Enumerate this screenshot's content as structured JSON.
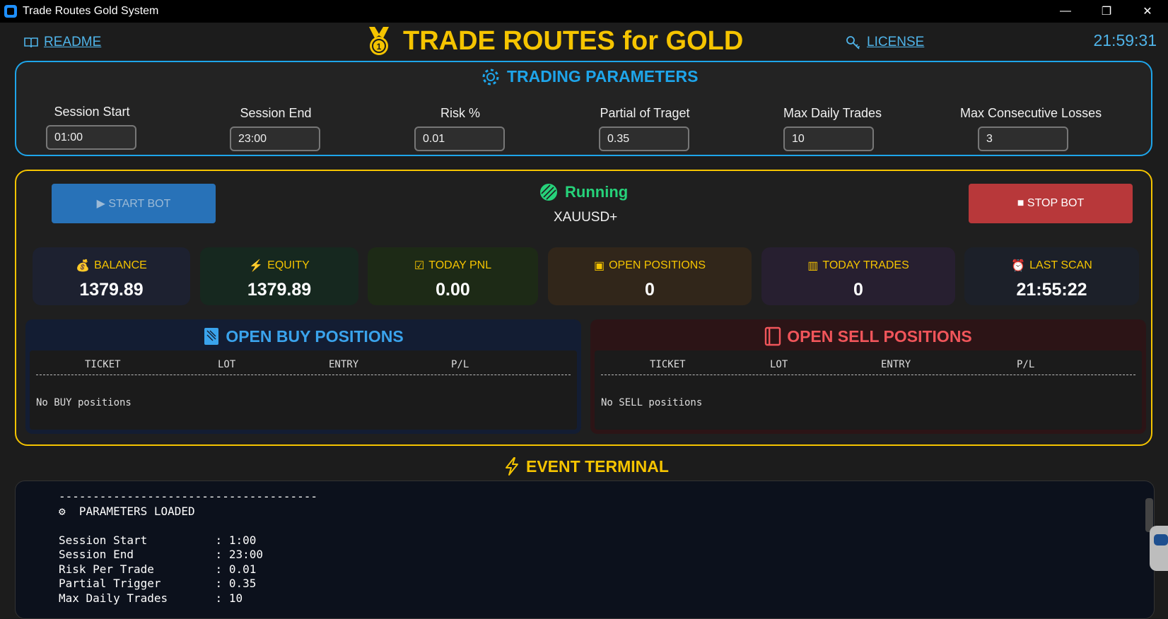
{
  "window": {
    "title": "Trade Routes Gold System",
    "controls": [
      "—",
      "❐",
      "✕"
    ]
  },
  "header": {
    "readme_label": "README",
    "app_title": "TRADE ROUTES for GOLD",
    "license_label": "LICENSE",
    "clock": "21:59:31"
  },
  "parameters": {
    "title": "TRADING PARAMETERS",
    "fields": [
      {
        "label": "Session Start",
        "value": "01:00"
      },
      {
        "label": "Session End",
        "value": "23:00"
      },
      {
        "label": "Risk %",
        "value": "0.01"
      },
      {
        "label": "Partial of Traget",
        "value": "0.35"
      },
      {
        "label": "Max Daily Trades",
        "value": "10"
      },
      {
        "label": "Max Consecutive Losses",
        "value": "3"
      }
    ]
  },
  "controls": {
    "start_label": "▶ START BOT",
    "stop_label": "■ STOP BOT",
    "status": "Running",
    "symbol": "XAUUSD+"
  },
  "stats": [
    {
      "label": "BALANCE",
      "value": "1379.89",
      "icon": "moneybag-icon"
    },
    {
      "label": "EQUITY",
      "value": "1379.89",
      "icon": "lightning-icon"
    },
    {
      "label": "TODAY PNL",
      "value": "0.00",
      "icon": "chart-icon"
    },
    {
      "label": "OPEN POSITIONS",
      "value": "0",
      "icon": "box-icon"
    },
    {
      "label": "TODAY TRADES",
      "value": "0",
      "icon": "bar-chart-icon"
    },
    {
      "label": "LAST SCAN",
      "value": "21:55:22",
      "icon": "alarm-clock-icon"
    }
  ],
  "buy_panel": {
    "title": "OPEN BUY POSITIONS",
    "columns": [
      "TICKET",
      "LOT",
      "ENTRY",
      "P/L"
    ],
    "empty": "No BUY positions"
  },
  "sell_panel": {
    "title": "OPEN SELL POSITIONS",
    "columns": [
      "TICKET",
      "LOT",
      "ENTRY",
      "P/L"
    ],
    "empty": "No SELL positions"
  },
  "terminal": {
    "title": "EVENT TERMINAL",
    "lines": [
      "--------------------------------------",
      "⚙  PARAMETERS LOADED",
      "",
      "Session Start          : 1:00",
      "Session End            : 23:00",
      "Risk Per Trade         : 0.01",
      "Partial Trigger        : 0.35",
      "Max Daily Trades       : 10"
    ]
  },
  "colors": {
    "accent_blue": "#1ea5ea",
    "accent_gold": "#f5c400",
    "running_green": "#26d27a",
    "stop_red": "#b8383a",
    "sell_red": "#f0555a",
    "buy_blue": "#3aa3ec"
  }
}
